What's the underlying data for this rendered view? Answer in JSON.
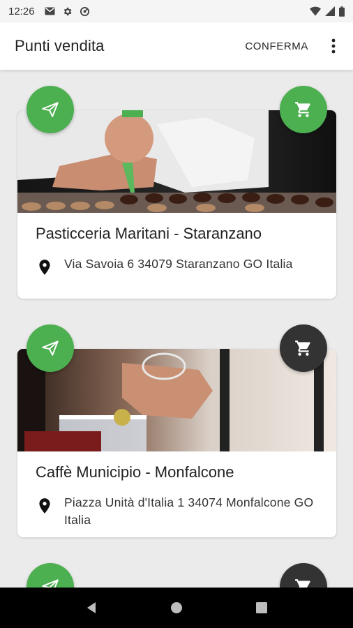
{
  "status_bar": {
    "time": "12:26",
    "left_icons": [
      "gmail-icon",
      "settings-icon",
      "vpn-icon"
    ],
    "right_icons": [
      "wifi-icon",
      "signal-icon",
      "battery-icon"
    ]
  },
  "app_bar": {
    "title": "Punti vendita",
    "confirm_label": "CONFERMA",
    "menu_icon": "more-vert-icon"
  },
  "stores": [
    {
      "name": "Pasticceria Maritani - Staranzano",
      "address": "Via Savoia 6 34079 Staranzano GO Italia",
      "send_icon": "send-icon",
      "cart_icon": "cart-icon",
      "cart_selected": true
    },
    {
      "name": "Caffè Municipio - Monfalcone",
      "address": "Piazza Unità d'Italia 1 34074 Monfalcone GO Italia",
      "send_icon": "send-icon",
      "cart_icon": "cart-icon",
      "cart_selected": false
    }
  ],
  "colors": {
    "accent_green": "#4caf50",
    "dark_fab": "#333333",
    "background": "#ebebeb"
  },
  "nav_bar": {
    "back_icon": "back-icon",
    "home_icon": "home-icon",
    "recents_icon": "recents-icon"
  }
}
